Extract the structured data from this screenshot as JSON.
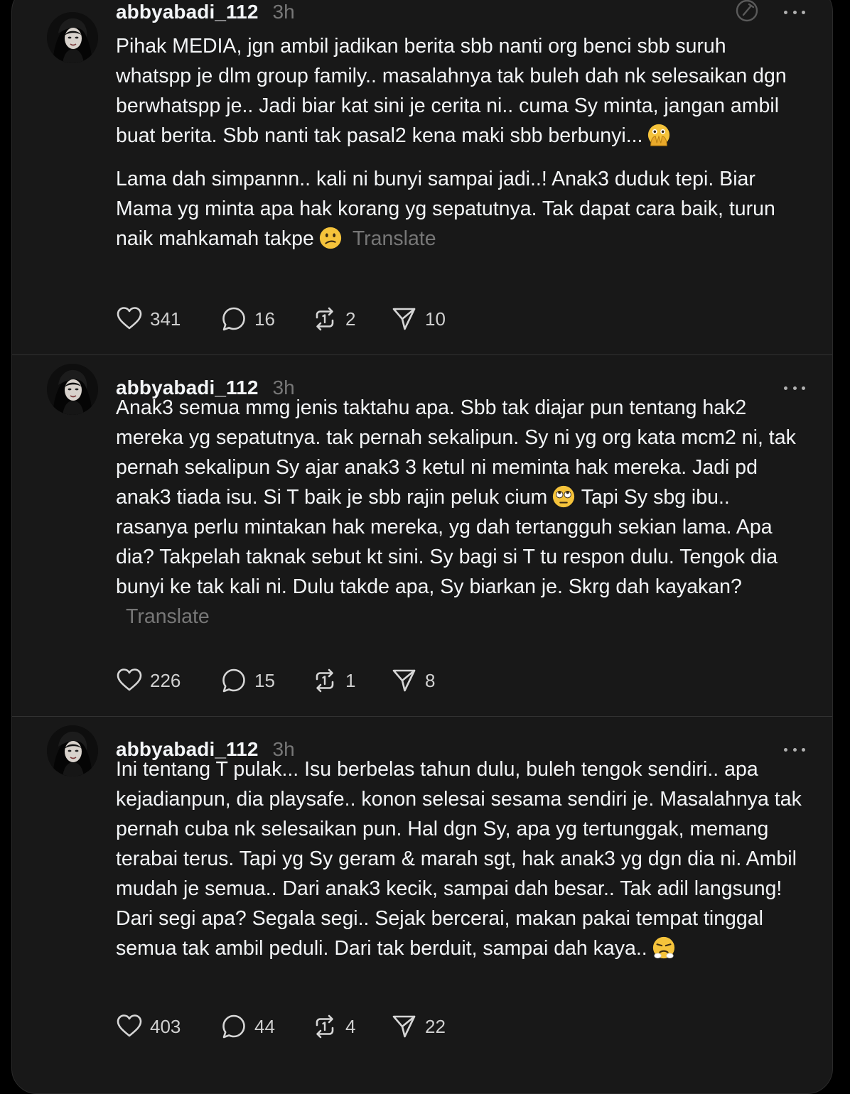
{
  "posts": [
    {
      "username": "abbyabadi_112",
      "time": "3h",
      "paragraphs": [
        "Pihak MEDIA, jgn ambil jadikan berita sbb nanti org benci sbb suruh whatspp je dlm group family.. masalahnya tak buleh dah nk selesaikan dgn berwhatspp je.. Jadi biar kat sini je cerita ni.. cuma Sy minta, jangan ambil buat berita. Sbb nanti tak pasal2 kena maki sbb berbunyi...",
        "Lama dah simpannn.. kali ni bunyi sampai jadi..! Anak3 duduk tepi. Biar Mama yg minta apa hak korang yg sepatutnya. Tak dapat cara baik, turun naik mahkamah takpe"
      ],
      "emojis": [
        "face-with-open-eyes-and-hand-over-mouth",
        "confused-face"
      ],
      "translate_label": "Translate",
      "likes": "341",
      "replies": "16",
      "reposts": "2",
      "shares": "10"
    },
    {
      "username": "abbyabadi_112",
      "time": "3h",
      "paragraphs": [
        "Anak3 semua mmg jenis taktahu apa. Sbb tak diajar pun tentang hak2 mereka yg sepatutnya. tak pernah sekalipun. Sy ni yg org kata mcm2 ni, tak pernah sekalipun Sy ajar anak3 3 ketul ni meminta hak mereka. Jadi pd anak3 tiada isu. Si T baik je sbb rajin peluk cium",
        "Tapi Sy sbg ibu.. rasanya perlu mintakan hak mereka, yg dah tertangguh sekian lama. Apa dia? Takpelah taknak sebut kt sini. Sy bagi si T tu respon dulu. Tengok dia bunyi ke tak kali ni. Dulu takde apa, Sy biarkan je. Skrg dah kayakan?"
      ],
      "emojis": [
        "face-with-rolling-eyes"
      ],
      "translate_label": "Translate",
      "likes": "226",
      "replies": "15",
      "reposts": "1",
      "shares": "8"
    },
    {
      "username": "abbyabadi_112",
      "time": "3h",
      "paragraphs": [
        "Ini tentang T pulak... Isu berbelas tahun dulu, buleh tengok sendiri.. apa kejadianpun, dia playsafe.. konon selesai sesama sendiri je. Masalahnya tak pernah cuba nk selesaikan pun. Hal dgn Sy, apa yg tertunggak, memang terabai terus. Tapi yg Sy geram & marah sgt, hak anak3 yg dgn dia ni. Ambil mudah je semua.. Dari anak3 kecik, sampai dah besar.. Tak adil langsung! Dari segi apa? Segala segi.. Sejak bercerai, makan pakai tempat tinggal semua tak ambil peduli. Dari tak berduit, sampai dah kaya.."
      ],
      "emojis": [
        "face-with-steam-from-nose"
      ],
      "likes": "403",
      "replies": "44",
      "reposts": "4",
      "shares": "22"
    }
  ],
  "icons": {
    "like": "heart-icon",
    "reply": "comment-bubble-icon",
    "repost": "repost-icon",
    "share": "send-icon",
    "more": "more-dots-icon",
    "compose": "compose-icon"
  },
  "colors": {
    "background": "#000000",
    "card": "#181818",
    "text": "#f3f5f7",
    "secondary": "#777777",
    "divider": "#323232"
  }
}
